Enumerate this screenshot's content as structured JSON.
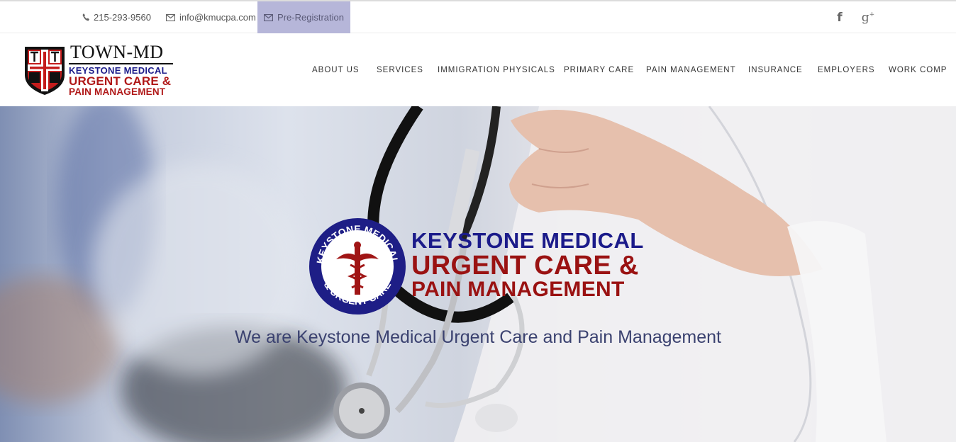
{
  "topbar": {
    "phone": "215-293-9560",
    "email": "info@kmucpa.com",
    "prereg": "Pre-Registration",
    "social_facebook": "f",
    "social_gplus": "g",
    "social_gplus_sup": "+",
    "icons": [
      "phone-icon",
      "envelope-icon",
      "envelope-icon",
      "facebook-icon",
      "google-plus-icon"
    ]
  },
  "logo": {
    "title": "TOWN-MD",
    "line1": "KEYSTONE MEDICAL",
    "line2": "URGENT CARE &",
    "line3": "PAIN MANAGEMENT"
  },
  "nav": {
    "items": [
      {
        "label": "ABOUT US"
      },
      {
        "label": "SERVICES"
      },
      {
        "label": "IMMIGRATION PHYSICALS"
      },
      {
        "label": "PRIMARY CARE"
      },
      {
        "label": "PAIN MANAGEMENT"
      },
      {
        "label": "INSURANCE"
      },
      {
        "label": "EMPLOYERS"
      },
      {
        "label": "WORK COMP"
      }
    ]
  },
  "hero": {
    "seal_top": "KEYSTONE MEDICAL",
    "seal_bottom": "& URGENT CARE",
    "line1": "KEYSTONE MEDICAL",
    "line2": "URGENT CARE &",
    "line3": "PAIN MANAGEMENT",
    "subtitle": "We are Keystone Medical Urgent Care and Pain Management"
  },
  "colors": {
    "prereg_bg": "#b6b6d9",
    "brand_blue": "#1b1b8a",
    "brand_red": "#b01818"
  }
}
